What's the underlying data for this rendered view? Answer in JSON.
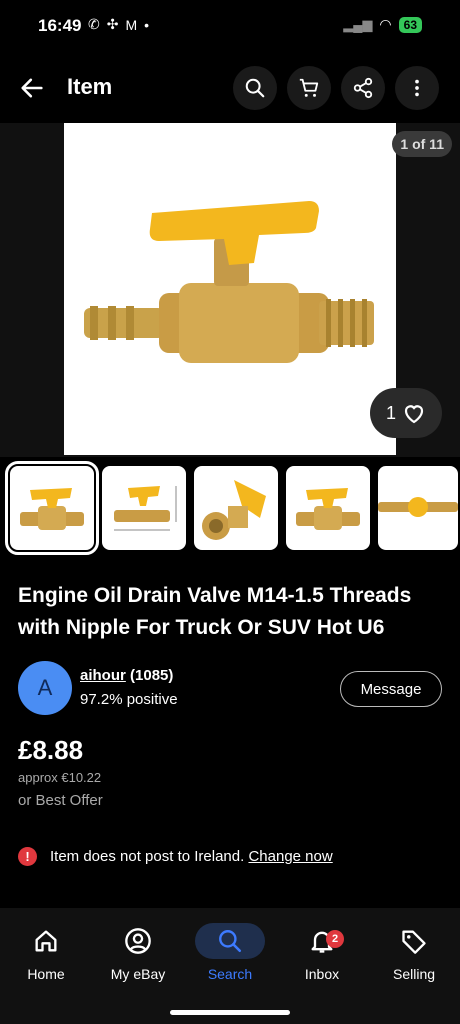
{
  "status": {
    "time": "16:49",
    "battery": "63"
  },
  "header": {
    "title": "Item"
  },
  "gallery": {
    "counter": "1 of 11",
    "watchers": "1"
  },
  "item": {
    "title": "Engine Oil Drain Valve M14-1.5 Threads with Nipple For Truck Or SUV Hot U6"
  },
  "seller": {
    "initial": "A",
    "name": "aihour",
    "rating_count": "(1085)",
    "positive": "97.2% positive",
    "message_label": "Message"
  },
  "pricing": {
    "price": "£8.88",
    "approx": "approx €10.22",
    "offer": "or Best Offer"
  },
  "shipping_notice": {
    "text": "Item does not post to Ireland.",
    "link": "Change now"
  },
  "nav": [
    {
      "label": "Home"
    },
    {
      "label": "My eBay"
    },
    {
      "label": "Search"
    },
    {
      "label": "Inbox",
      "badge": "2"
    },
    {
      "label": "Selling"
    }
  ]
}
